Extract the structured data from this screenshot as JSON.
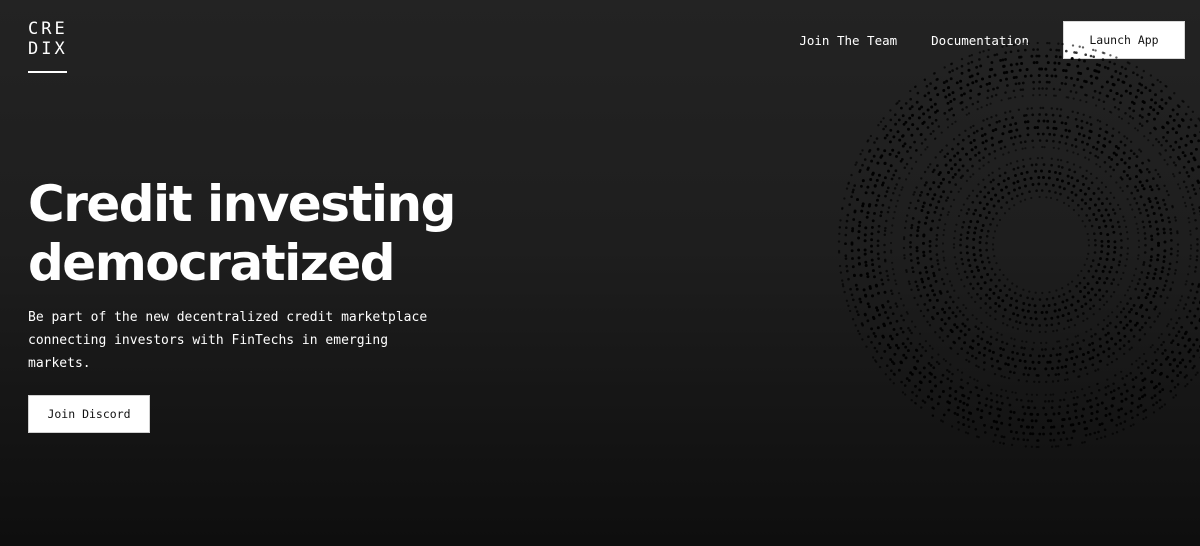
{
  "brand": {
    "logo_line1": "CRE",
    "logo_line2": "DIX"
  },
  "nav": {
    "join_team": "Join The Team",
    "documentation": "Documentation",
    "launch_app": "Launch App"
  },
  "hero": {
    "headline_line1": "Credit investing",
    "headline_line2": "democratized",
    "subtitle": "Be part of the new decentralized credit marketplace connecting investors with FinTechs in emerging markets.",
    "cta_label": "Join Discord"
  },
  "colors": {
    "background": "#1e1e1e",
    "text": "#ffffff",
    "button_bg": "#ffffff",
    "button_text": "#111111",
    "dots": "#000000"
  },
  "decoration": {
    "type": "concentric-dotted-rings",
    "ring_count": 3
  }
}
